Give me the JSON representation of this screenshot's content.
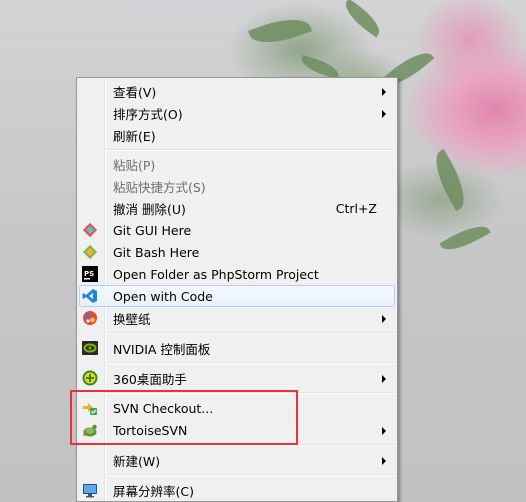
{
  "menu": {
    "items": [
      {
        "label": "查看(V)",
        "submenu": true
      },
      {
        "label": "排序方式(O)",
        "submenu": true
      },
      {
        "label": "刷新(E)"
      },
      {
        "label": "粘贴(P)",
        "disabled": true
      },
      {
        "label": "粘贴快捷方式(S)",
        "disabled": true
      },
      {
        "label": "撤消 删除(U)",
        "shortcut": "Ctrl+Z"
      },
      {
        "label": "Git GUI Here",
        "icon": "git-gui-icon"
      },
      {
        "label": "Git Bash Here",
        "icon": "git-bash-icon"
      },
      {
        "label": "Open Folder as PhpStorm Project",
        "icon": "phpstorm-icon"
      },
      {
        "label": "Open with Code",
        "icon": "vscode-icon",
        "highlighted": true
      },
      {
        "label": "换壁纸",
        "icon": "wallpaper-icon",
        "submenu": true
      },
      {
        "label": "NVIDIA 控制面板",
        "icon": "nvidia-icon"
      },
      {
        "label": "360桌面助手",
        "icon": "360-icon",
        "submenu": true
      },
      {
        "label": "SVN Checkout...",
        "icon": "svn-checkout-icon"
      },
      {
        "label": "TortoiseSVN",
        "icon": "tortoisesvn-icon",
        "submenu": true
      },
      {
        "label": "新建(W)",
        "submenu": true
      },
      {
        "label": "屏幕分辨率(C)",
        "icon": "screen-resolution-icon"
      }
    ]
  },
  "colors": {
    "highlight_box": "#e5343a",
    "menu_bg": "#f0f0f0",
    "hover_border": "#aecff7"
  }
}
